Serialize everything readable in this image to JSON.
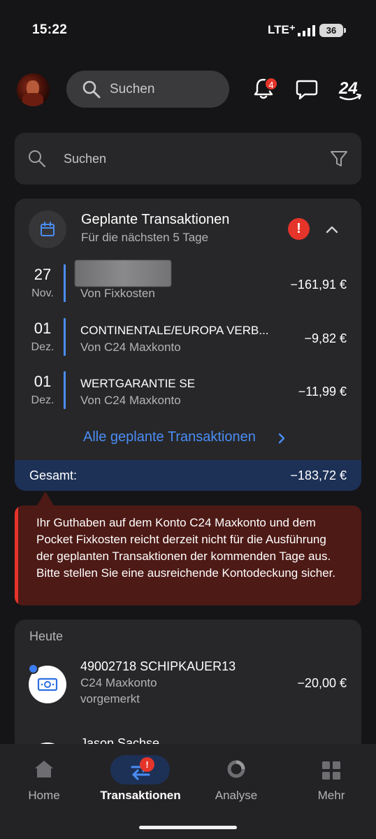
{
  "status": {
    "time": "15:22",
    "network": "LTE⁺",
    "battery": "36"
  },
  "header": {
    "search_placeholder": "Suchen",
    "notification_count": "4",
    "brand_label": "24"
  },
  "search_card": {
    "placeholder": "Suchen"
  },
  "planned": {
    "title": "Geplante Transaktionen",
    "subtitle": "Für die nächsten 5 Tage",
    "alert_symbol": "!",
    "transactions": [
      {
        "day": "27",
        "month": "Nov.",
        "name": "",
        "from": "Von Fixkosten",
        "amount": "−161,91 €"
      },
      {
        "day": "01",
        "month": "Dez.",
        "name": "CONTINENTALE/EUROPA VERB...",
        "from": "Von C24 Maxkonto",
        "amount": "−9,82 €"
      },
      {
        "day": "01",
        "month": "Dez.",
        "name": "WERTGARANTIE SE",
        "from": "Von C24 Maxkonto",
        "amount": "−11,99 €"
      }
    ],
    "all_link": "Alle geplante Transaktionen",
    "total_label": "Gesamt:",
    "total_amount": "−183,72 €"
  },
  "warning": {
    "text": "Ihr Guthaben auf dem Konto C24 Maxkonto und dem Pocket Fixkosten reicht derzeit nicht für die Ausführung der geplanten Transaktionen der kommenden Tage aus. Bitte stellen Sie eine ausreichende Kontodeckung sicher."
  },
  "today": {
    "label": "Heute",
    "items": [
      {
        "name": "49002718 SCHIPKAUER13",
        "account": "C24 Maxkonto",
        "status": "vorgemerkt",
        "amount": "−20,00 €"
      },
      {
        "name": "Jason Sachse"
      }
    ]
  },
  "nav": {
    "items": [
      {
        "label": "Home"
      },
      {
        "label": "Transaktionen",
        "badge": "!"
      },
      {
        "label": "Analyse"
      },
      {
        "label": "Mehr"
      }
    ]
  },
  "colors": {
    "accent": "#4a8df5",
    "alert": "#e5342a",
    "warning_bg": "#4e1a16",
    "total_bg": "#1d3157"
  }
}
